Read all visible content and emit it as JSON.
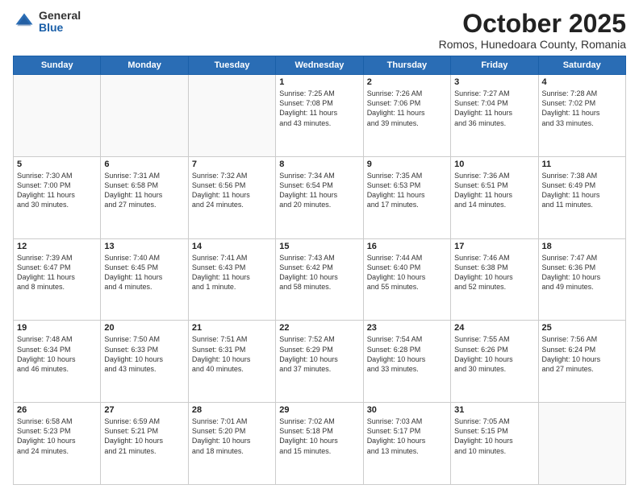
{
  "header": {
    "logo_general": "General",
    "logo_blue": "Blue",
    "title": "October 2025",
    "subtitle": "Romos, Hunedoara County, Romania"
  },
  "days_of_week": [
    "Sunday",
    "Monday",
    "Tuesday",
    "Wednesday",
    "Thursday",
    "Friday",
    "Saturday"
  ],
  "weeks": [
    [
      {
        "day": "",
        "info": ""
      },
      {
        "day": "",
        "info": ""
      },
      {
        "day": "",
        "info": ""
      },
      {
        "day": "1",
        "info": "Sunrise: 7:25 AM\nSunset: 7:08 PM\nDaylight: 11 hours\nand 43 minutes."
      },
      {
        "day": "2",
        "info": "Sunrise: 7:26 AM\nSunset: 7:06 PM\nDaylight: 11 hours\nand 39 minutes."
      },
      {
        "day": "3",
        "info": "Sunrise: 7:27 AM\nSunset: 7:04 PM\nDaylight: 11 hours\nand 36 minutes."
      },
      {
        "day": "4",
        "info": "Sunrise: 7:28 AM\nSunset: 7:02 PM\nDaylight: 11 hours\nand 33 minutes."
      }
    ],
    [
      {
        "day": "5",
        "info": "Sunrise: 7:30 AM\nSunset: 7:00 PM\nDaylight: 11 hours\nand 30 minutes."
      },
      {
        "day": "6",
        "info": "Sunrise: 7:31 AM\nSunset: 6:58 PM\nDaylight: 11 hours\nand 27 minutes."
      },
      {
        "day": "7",
        "info": "Sunrise: 7:32 AM\nSunset: 6:56 PM\nDaylight: 11 hours\nand 24 minutes."
      },
      {
        "day": "8",
        "info": "Sunrise: 7:34 AM\nSunset: 6:54 PM\nDaylight: 11 hours\nand 20 minutes."
      },
      {
        "day": "9",
        "info": "Sunrise: 7:35 AM\nSunset: 6:53 PM\nDaylight: 11 hours\nand 17 minutes."
      },
      {
        "day": "10",
        "info": "Sunrise: 7:36 AM\nSunset: 6:51 PM\nDaylight: 11 hours\nand 14 minutes."
      },
      {
        "day": "11",
        "info": "Sunrise: 7:38 AM\nSunset: 6:49 PM\nDaylight: 11 hours\nand 11 minutes."
      }
    ],
    [
      {
        "day": "12",
        "info": "Sunrise: 7:39 AM\nSunset: 6:47 PM\nDaylight: 11 hours\nand 8 minutes."
      },
      {
        "day": "13",
        "info": "Sunrise: 7:40 AM\nSunset: 6:45 PM\nDaylight: 11 hours\nand 4 minutes."
      },
      {
        "day": "14",
        "info": "Sunrise: 7:41 AM\nSunset: 6:43 PM\nDaylight: 11 hours\nand 1 minute."
      },
      {
        "day": "15",
        "info": "Sunrise: 7:43 AM\nSunset: 6:42 PM\nDaylight: 10 hours\nand 58 minutes."
      },
      {
        "day": "16",
        "info": "Sunrise: 7:44 AM\nSunset: 6:40 PM\nDaylight: 10 hours\nand 55 minutes."
      },
      {
        "day": "17",
        "info": "Sunrise: 7:46 AM\nSunset: 6:38 PM\nDaylight: 10 hours\nand 52 minutes."
      },
      {
        "day": "18",
        "info": "Sunrise: 7:47 AM\nSunset: 6:36 PM\nDaylight: 10 hours\nand 49 minutes."
      }
    ],
    [
      {
        "day": "19",
        "info": "Sunrise: 7:48 AM\nSunset: 6:34 PM\nDaylight: 10 hours\nand 46 minutes."
      },
      {
        "day": "20",
        "info": "Sunrise: 7:50 AM\nSunset: 6:33 PM\nDaylight: 10 hours\nand 43 minutes."
      },
      {
        "day": "21",
        "info": "Sunrise: 7:51 AM\nSunset: 6:31 PM\nDaylight: 10 hours\nand 40 minutes."
      },
      {
        "day": "22",
        "info": "Sunrise: 7:52 AM\nSunset: 6:29 PM\nDaylight: 10 hours\nand 37 minutes."
      },
      {
        "day": "23",
        "info": "Sunrise: 7:54 AM\nSunset: 6:28 PM\nDaylight: 10 hours\nand 33 minutes."
      },
      {
        "day": "24",
        "info": "Sunrise: 7:55 AM\nSunset: 6:26 PM\nDaylight: 10 hours\nand 30 minutes."
      },
      {
        "day": "25",
        "info": "Sunrise: 7:56 AM\nSunset: 6:24 PM\nDaylight: 10 hours\nand 27 minutes."
      }
    ],
    [
      {
        "day": "26",
        "info": "Sunrise: 6:58 AM\nSunset: 5:23 PM\nDaylight: 10 hours\nand 24 minutes."
      },
      {
        "day": "27",
        "info": "Sunrise: 6:59 AM\nSunset: 5:21 PM\nDaylight: 10 hours\nand 21 minutes."
      },
      {
        "day": "28",
        "info": "Sunrise: 7:01 AM\nSunset: 5:20 PM\nDaylight: 10 hours\nand 18 minutes."
      },
      {
        "day": "29",
        "info": "Sunrise: 7:02 AM\nSunset: 5:18 PM\nDaylight: 10 hours\nand 15 minutes."
      },
      {
        "day": "30",
        "info": "Sunrise: 7:03 AM\nSunset: 5:17 PM\nDaylight: 10 hours\nand 13 minutes."
      },
      {
        "day": "31",
        "info": "Sunrise: 7:05 AM\nSunset: 5:15 PM\nDaylight: 10 hours\nand 10 minutes."
      },
      {
        "day": "",
        "info": ""
      }
    ]
  ]
}
